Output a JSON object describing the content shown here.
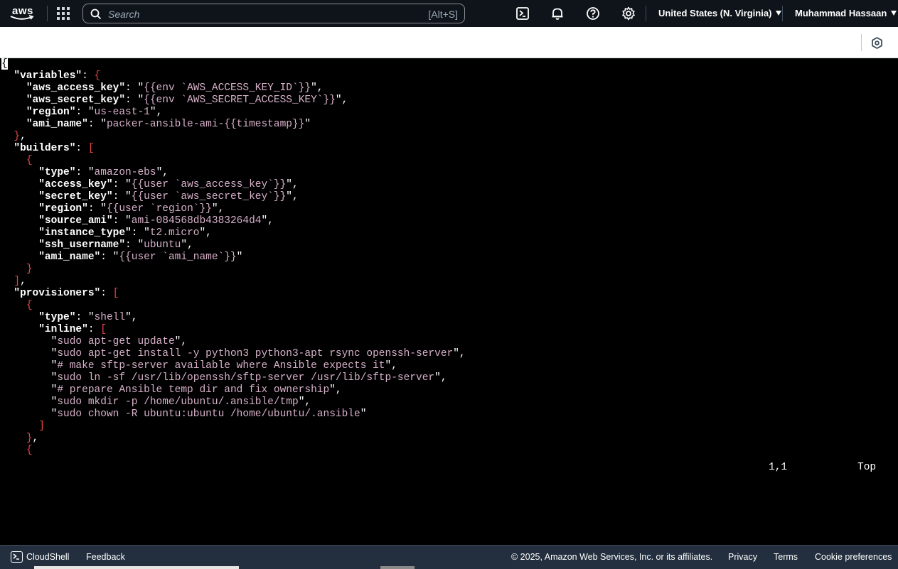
{
  "nav": {
    "logo_text": "aws",
    "search_placeholder": "Search",
    "search_shortcut": "[Alt+S]",
    "region": "United States (N. Virginia)",
    "user": "Muhammad Hassaan",
    "icons": [
      "services-grid-icon",
      "cloudshell-icon",
      "bell-icon",
      "help-icon",
      "gear-icon"
    ]
  },
  "toolbar": {
    "icons": [
      "settings-hexagon-icon"
    ]
  },
  "terminal": {
    "lines": [
      {
        "parts": [
          {
            "t": "{",
            "c": "cursor"
          }
        ]
      },
      {
        "parts": [
          {
            "t": "  ",
            "c": "p"
          },
          {
            "t": "\"variables\"",
            "c": "k"
          },
          {
            "t": ": ",
            "c": "p"
          },
          {
            "t": "{",
            "c": "b"
          }
        ]
      },
      {
        "parts": [
          {
            "t": "    ",
            "c": "p"
          },
          {
            "t": "\"aws_access_key\"",
            "c": "k"
          },
          {
            "t": ": \"",
            "c": "p"
          },
          {
            "t": "{{env `AWS_ACCESS_KEY_ID`}}",
            "c": "s"
          },
          {
            "t": "\",",
            "c": "p"
          }
        ]
      },
      {
        "parts": [
          {
            "t": "    ",
            "c": "p"
          },
          {
            "t": "\"aws_secret_key\"",
            "c": "k"
          },
          {
            "t": ": \"",
            "c": "p"
          },
          {
            "t": "{{env `AWS_SECRET_ACCESS_KEY`}}",
            "c": "s"
          },
          {
            "t": "\",",
            "c": "p"
          }
        ]
      },
      {
        "parts": [
          {
            "t": "    ",
            "c": "p"
          },
          {
            "t": "\"region\"",
            "c": "k"
          },
          {
            "t": ": \"",
            "c": "p"
          },
          {
            "t": "us-east-1",
            "c": "s"
          },
          {
            "t": "\",",
            "c": "p"
          }
        ]
      },
      {
        "parts": [
          {
            "t": "    ",
            "c": "p"
          },
          {
            "t": "\"ami_name\"",
            "c": "k"
          },
          {
            "t": ": \"",
            "c": "p"
          },
          {
            "t": "packer-ansible-ami-{{timestamp}}",
            "c": "s"
          },
          {
            "t": "\"",
            "c": "p"
          }
        ]
      },
      {
        "parts": [
          {
            "t": "  ",
            "c": "p"
          },
          {
            "t": "}",
            "c": "b"
          },
          {
            "t": ",",
            "c": "p"
          }
        ]
      },
      {
        "parts": [
          {
            "t": "  ",
            "c": "p"
          },
          {
            "t": "\"builders\"",
            "c": "k"
          },
          {
            "t": ": ",
            "c": "p"
          },
          {
            "t": "[",
            "c": "b"
          }
        ]
      },
      {
        "parts": [
          {
            "t": "    ",
            "c": "p"
          },
          {
            "t": "{",
            "c": "b"
          }
        ]
      },
      {
        "parts": [
          {
            "t": "      ",
            "c": "p"
          },
          {
            "t": "\"type\"",
            "c": "k"
          },
          {
            "t": ": \"",
            "c": "p"
          },
          {
            "t": "amazon-ebs",
            "c": "s"
          },
          {
            "t": "\",",
            "c": "p"
          }
        ]
      },
      {
        "parts": [
          {
            "t": "      ",
            "c": "p"
          },
          {
            "t": "\"access_key\"",
            "c": "k"
          },
          {
            "t": ": \"",
            "c": "p"
          },
          {
            "t": "{{user `aws_access_key`}}",
            "c": "s"
          },
          {
            "t": "\",",
            "c": "p"
          }
        ]
      },
      {
        "parts": [
          {
            "t": "      ",
            "c": "p"
          },
          {
            "t": "\"secret_key\"",
            "c": "k"
          },
          {
            "t": ": \"",
            "c": "p"
          },
          {
            "t": "{{user `aws_secret_key`}}",
            "c": "s"
          },
          {
            "t": "\",",
            "c": "p"
          }
        ]
      },
      {
        "parts": [
          {
            "t": "      ",
            "c": "p"
          },
          {
            "t": "\"region\"",
            "c": "k"
          },
          {
            "t": ": \"",
            "c": "p"
          },
          {
            "t": "{{user `region`}}",
            "c": "s"
          },
          {
            "t": "\",",
            "c": "p"
          }
        ]
      },
      {
        "parts": [
          {
            "t": "      ",
            "c": "p"
          },
          {
            "t": "\"source_ami\"",
            "c": "k"
          },
          {
            "t": ": \"",
            "c": "p"
          },
          {
            "t": "ami-084568db4383264d4",
            "c": "s"
          },
          {
            "t": "\",",
            "c": "p"
          }
        ]
      },
      {
        "parts": [
          {
            "t": "      ",
            "c": "p"
          },
          {
            "t": "\"instance_type\"",
            "c": "k"
          },
          {
            "t": ": \"",
            "c": "p"
          },
          {
            "t": "t2.micro",
            "c": "s"
          },
          {
            "t": "\",",
            "c": "p"
          }
        ]
      },
      {
        "parts": [
          {
            "t": "      ",
            "c": "p"
          },
          {
            "t": "\"ssh_username\"",
            "c": "k"
          },
          {
            "t": ": \"",
            "c": "p"
          },
          {
            "t": "ubuntu",
            "c": "s"
          },
          {
            "t": "\",",
            "c": "p"
          }
        ]
      },
      {
        "parts": [
          {
            "t": "      ",
            "c": "p"
          },
          {
            "t": "\"ami_name\"",
            "c": "k"
          },
          {
            "t": ": \"",
            "c": "p"
          },
          {
            "t": "{{user `ami_name`}}",
            "c": "s"
          },
          {
            "t": "\"",
            "c": "p"
          }
        ]
      },
      {
        "parts": [
          {
            "t": "    ",
            "c": "p"
          },
          {
            "t": "}",
            "c": "b"
          }
        ]
      },
      {
        "parts": [
          {
            "t": "  ",
            "c": "p"
          },
          {
            "t": "]",
            "c": "b"
          },
          {
            "t": ",",
            "c": "p"
          }
        ]
      },
      {
        "parts": [
          {
            "t": "  ",
            "c": "p"
          },
          {
            "t": "\"provisioners\"",
            "c": "k"
          },
          {
            "t": ": ",
            "c": "p"
          },
          {
            "t": "[",
            "c": "b"
          }
        ]
      },
      {
        "parts": [
          {
            "t": "    ",
            "c": "p"
          },
          {
            "t": "{",
            "c": "b"
          }
        ]
      },
      {
        "parts": [
          {
            "t": "      ",
            "c": "p"
          },
          {
            "t": "\"type\"",
            "c": "k"
          },
          {
            "t": ": \"",
            "c": "p"
          },
          {
            "t": "shell",
            "c": "s"
          },
          {
            "t": "\",",
            "c": "p"
          }
        ]
      },
      {
        "parts": [
          {
            "t": "      ",
            "c": "p"
          },
          {
            "t": "\"inline\"",
            "c": "k"
          },
          {
            "t": ": ",
            "c": "p"
          },
          {
            "t": "[",
            "c": "b"
          }
        ]
      },
      {
        "parts": [
          {
            "t": "        \"",
            "c": "p"
          },
          {
            "t": "sudo apt-get update",
            "c": "s"
          },
          {
            "t": "\",",
            "c": "p"
          }
        ]
      },
      {
        "parts": [
          {
            "t": "        \"",
            "c": "p"
          },
          {
            "t": "sudo apt-get install -y python3 python3-apt rsync openssh-server",
            "c": "s"
          },
          {
            "t": "\",",
            "c": "p"
          }
        ]
      },
      {
        "parts": [
          {
            "t": "        \"",
            "c": "p"
          },
          {
            "t": "# make sftp-server available where Ansible expects it",
            "c": "s"
          },
          {
            "t": "\",",
            "c": "p"
          }
        ]
      },
      {
        "parts": [
          {
            "t": "        \"",
            "c": "p"
          },
          {
            "t": "sudo ln -sf /usr/lib/openssh/sftp-server /usr/lib/sftp-server",
            "c": "s"
          },
          {
            "t": "\",",
            "c": "p"
          }
        ]
      },
      {
        "parts": [
          {
            "t": "        \"",
            "c": "p"
          },
          {
            "t": "# prepare Ansible temp dir and fix ownership",
            "c": "s"
          },
          {
            "t": "\",",
            "c": "p"
          }
        ]
      },
      {
        "parts": [
          {
            "t": "        \"",
            "c": "p"
          },
          {
            "t": "sudo mkdir -p /home/ubuntu/.ansible/tmp",
            "c": "s"
          },
          {
            "t": "\",",
            "c": "p"
          }
        ]
      },
      {
        "parts": [
          {
            "t": "        \"",
            "c": "p"
          },
          {
            "t": "sudo chown -R ubuntu:ubuntu /home/ubuntu/.ansible",
            "c": "s"
          },
          {
            "t": "\"",
            "c": "p"
          }
        ]
      },
      {
        "parts": [
          {
            "t": "      ",
            "c": "p"
          },
          {
            "t": "]",
            "c": "b"
          }
        ]
      },
      {
        "parts": [
          {
            "t": "    ",
            "c": "p"
          },
          {
            "t": "}",
            "c": "b"
          },
          {
            "t": ",",
            "c": "p"
          }
        ]
      },
      {
        "parts": [
          {
            "t": "    ",
            "c": "p"
          },
          {
            "t": "{",
            "c": "b"
          }
        ]
      }
    ],
    "status_position": "1,1",
    "status_scroll": "Top"
  },
  "footer": {
    "cloudshell": "CloudShell",
    "feedback": "Feedback",
    "copyright": "© 2025, Amazon Web Services, Inc. or its affiliates.",
    "privacy": "Privacy",
    "terms": "Terms",
    "cookies": "Cookie preferences"
  },
  "colors": {
    "nav_bg": "#0f141a",
    "footer_bg": "#232f3e",
    "terminal_bg": "#000000",
    "json_key": "#ffffff",
    "json_string": "#d6b0c8",
    "json_bracket": "#e04646"
  }
}
